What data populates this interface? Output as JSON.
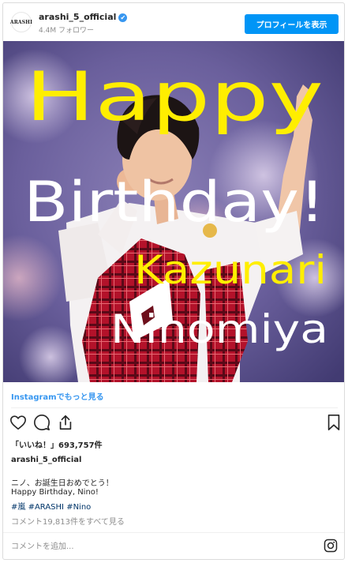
{
  "header": {
    "avatar_text": "ARASHI",
    "username": "arashi_5_official",
    "verified_mark": "✔",
    "followers": "4.4M フォロワー",
    "profile_button": "プロフィールを表示"
  },
  "photo": {
    "text_line1": "Happy",
    "text_line2": "Birthday!",
    "text_line3": "Kazunari",
    "text_line4": "Ninomiya"
  },
  "more_link": "Instagramでもっと見る",
  "actions": {
    "icons": [
      "heart-icon",
      "comment-icon",
      "share-icon",
      "bookmark-icon"
    ]
  },
  "likes": "「いいね！」693,757件",
  "account_name": "arashi_5_official",
  "caption": {
    "line1": "ニノ、お誕生日おめでとう！",
    "line2": "Happy Birthday, Nino!",
    "hashtags": [
      "#嵐",
      "#ARASHI",
      "#Nino"
    ]
  },
  "comments_link": "コメント19,813件をすべて見る",
  "comment_input": {
    "placeholder": "コメントを追加...",
    "value": ""
  },
  "colors": {
    "accent": "#0095f6",
    "link": "#3897f0",
    "hashtag": "#003569",
    "photo_yellow": "#ffee00",
    "photo_white": "#ffffff",
    "photo_bg": "#5e5895"
  }
}
